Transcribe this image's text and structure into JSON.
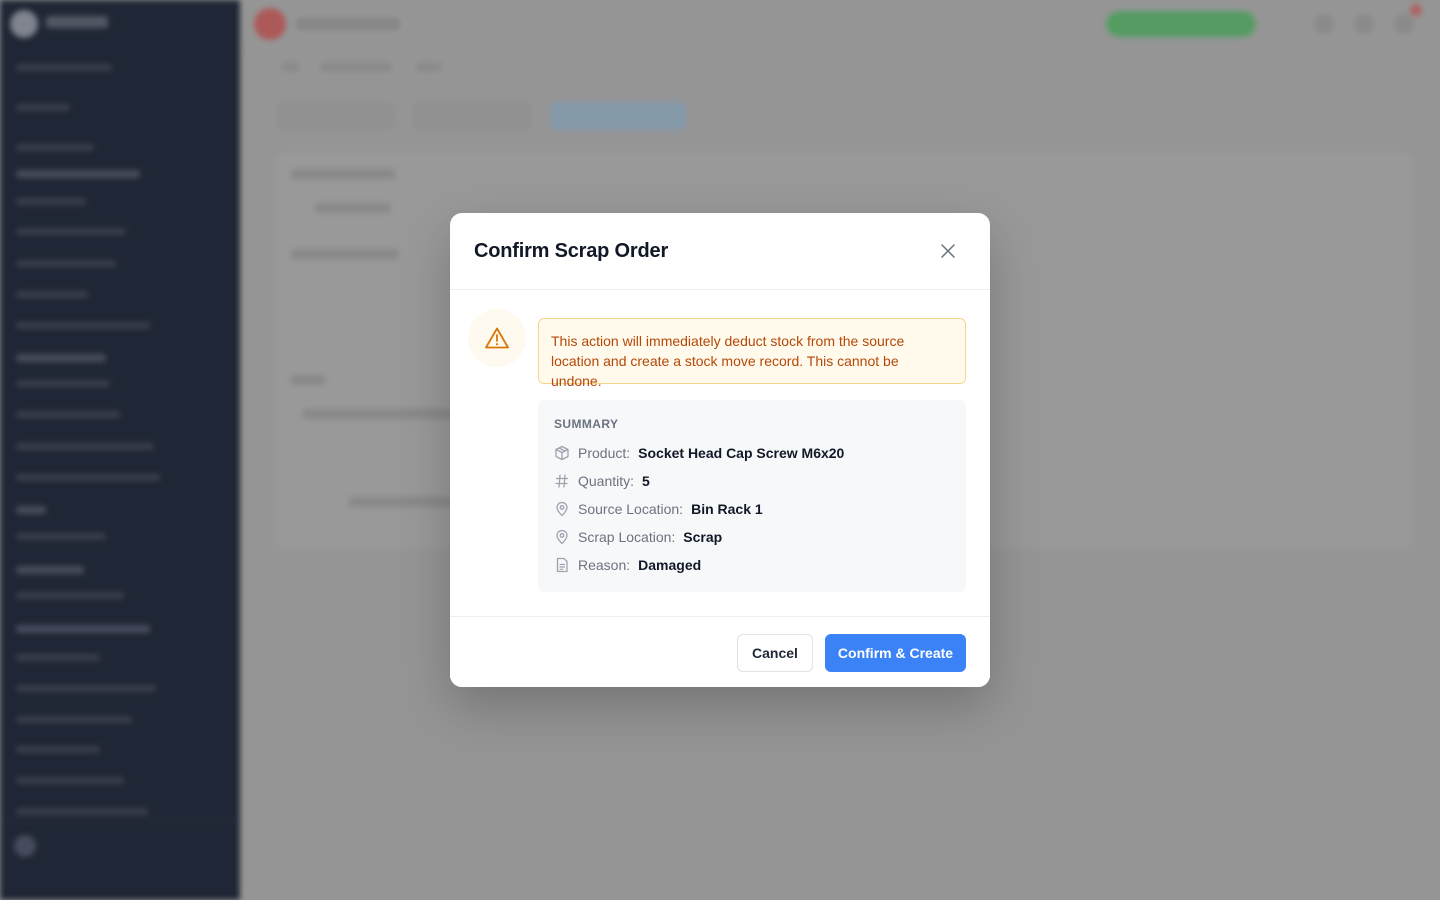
{
  "modal": {
    "title": "Confirm Scrap Order",
    "warning": "This action will immediately deduct stock from the source location and create a stock move record. This cannot be undone.",
    "summary": {
      "heading": "SUMMARY",
      "rows": [
        {
          "label": "Product:",
          "value": "Socket Head Cap Screw M6x20",
          "icon": "box-icon"
        },
        {
          "label": "Quantity:",
          "value": "5",
          "icon": "hash-icon"
        },
        {
          "label": "Source Location:",
          "value": "Bin Rack 1",
          "icon": "map-pin-icon"
        },
        {
          "label": "Scrap Location:",
          "value": "Scrap",
          "icon": "map-pin-icon"
        },
        {
          "label": "Reason:",
          "value": "Damaged",
          "icon": "document-icon"
        }
      ]
    },
    "buttons": {
      "cancel": "Cancel",
      "confirm": "Confirm & Create"
    }
  },
  "colors": {
    "primary": "#3b82f6",
    "warning_text": "#b54708",
    "warning_bg": "#fffaeb",
    "warning_border": "#f6d58c",
    "sidebar_bg": "#0c1426"
  }
}
